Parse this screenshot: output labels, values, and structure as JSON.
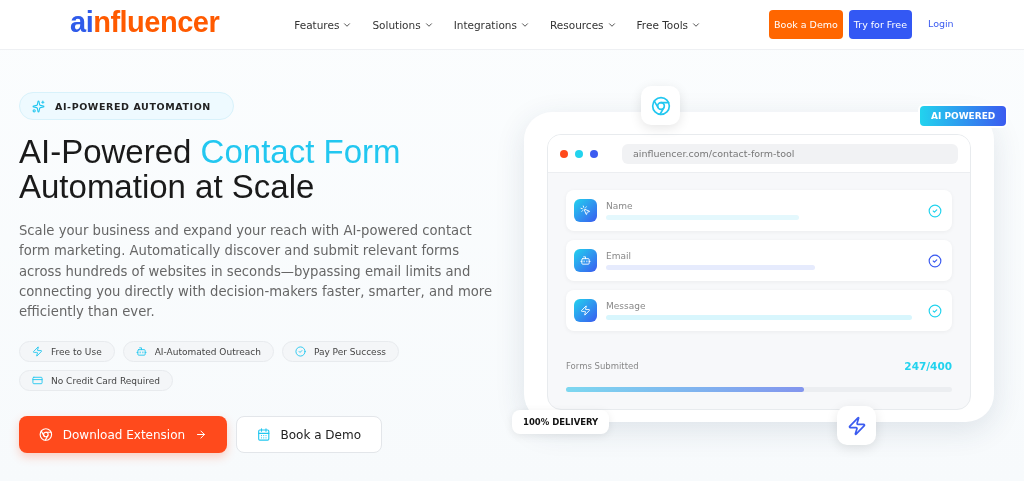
{
  "header": {
    "logo": [
      {
        "text": "ai",
        "color": "#2f5bea"
      },
      {
        "text": "nfluencer",
        "color": "#ff5a00"
      }
    ],
    "nav": [
      {
        "label": "Features"
      },
      {
        "label": "Solutions"
      },
      {
        "label": "Integrations"
      },
      {
        "label": "Resources"
      },
      {
        "label": "Free Tools"
      }
    ],
    "actions": [
      {
        "label": "Book a Demo",
        "kind": "orange"
      },
      {
        "label": "Try for Free",
        "kind": "blue"
      },
      {
        "label": "Login",
        "kind": "link"
      }
    ]
  },
  "hero": {
    "badge": "AI-POWERED AUTOMATION",
    "heading": [
      [
        {
          "text": "AI-Powered ",
          "highlight": false
        },
        {
          "text": "Contact Form",
          "highlight": true
        }
      ],
      [
        {
          "text": "Automation at Scale",
          "highlight": false
        }
      ]
    ],
    "description": "Scale your business and expand your reach with AI-powered contact form marketing. Automatically discover and submit relevant forms across hundreds of websites in seconds—bypassing email limits and connecting you directly with decision-makers faster, smarter, and more efficiently than ever.",
    "features": [
      {
        "label": "Free to Use"
      },
      {
        "label": "AI-Automated Outreach"
      },
      {
        "label": "Pay Per Success"
      },
      {
        "label": "No Credit Card Required"
      }
    ],
    "buttons": [
      {
        "label": "Download Extension",
        "kind": "primary"
      },
      {
        "label": "Book a Demo",
        "kind": "secondary"
      }
    ]
  },
  "mockup": {
    "badge": "AI POWERED",
    "url": "ainfluencer.com/contact-form-tool",
    "fields": [
      {
        "label": "Name"
      },
      {
        "label": "Email"
      },
      {
        "label": "Message"
      }
    ],
    "progress": {
      "label": "Forms Submitted",
      "reading": "247/400",
      "level": 0.6175
    },
    "delivery": "100% DELIVERY"
  }
}
